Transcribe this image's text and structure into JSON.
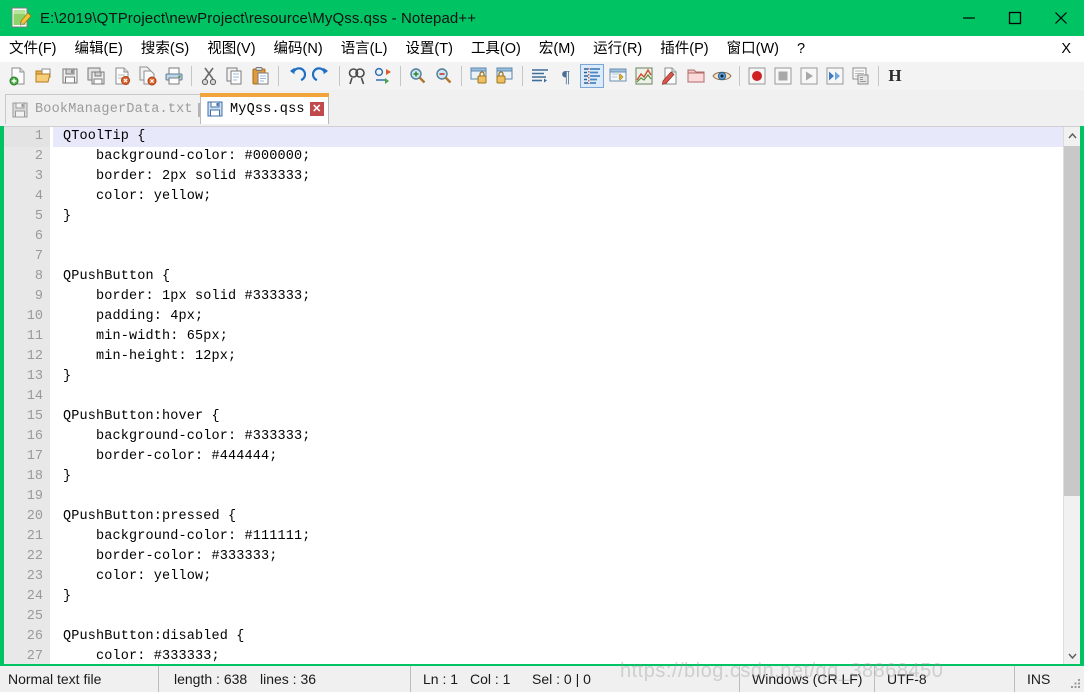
{
  "window": {
    "title": "E:\\2019\\QTProject\\newProject\\resource\\MyQss.qss - Notepad++",
    "icon": "notepad-document-icon",
    "titlebar_color": "#00c364",
    "controls": {
      "minimize": "minimize-icon",
      "maximize": "maximize-icon",
      "close": "close-icon"
    }
  },
  "menubar": {
    "items": [
      {
        "label": "文件(F)",
        "name": "menu-file"
      },
      {
        "label": "编辑(E)",
        "name": "menu-edit"
      },
      {
        "label": "搜索(S)",
        "name": "menu-search"
      },
      {
        "label": "视图(V)",
        "name": "menu-view"
      },
      {
        "label": "编码(N)",
        "name": "menu-encoding"
      },
      {
        "label": "语言(L)",
        "name": "menu-language"
      },
      {
        "label": "设置(T)",
        "name": "menu-settings"
      },
      {
        "label": "工具(O)",
        "name": "menu-tools"
      },
      {
        "label": "宏(M)",
        "name": "menu-macro"
      },
      {
        "label": "运行(R)",
        "name": "menu-run"
      },
      {
        "label": "插件(P)",
        "name": "menu-plugins"
      },
      {
        "label": "窗口(W)",
        "name": "menu-window"
      },
      {
        "label": "?",
        "name": "menu-help"
      }
    ],
    "close_doc_label": "X"
  },
  "toolbar": {
    "accent_active_bg": "#dcebfb",
    "buttons": [
      {
        "name": "new-file-icon"
      },
      {
        "name": "open-file-icon"
      },
      {
        "name": "save-icon"
      },
      {
        "name": "save-all-icon"
      },
      {
        "name": "close-file-icon"
      },
      {
        "name": "close-all-files-icon"
      },
      {
        "name": "print-icon"
      },
      {
        "name": "separator"
      },
      {
        "name": "cut-icon"
      },
      {
        "name": "copy-icon"
      },
      {
        "name": "paste-icon"
      },
      {
        "name": "separator"
      },
      {
        "name": "undo-icon"
      },
      {
        "name": "redo-icon"
      },
      {
        "name": "separator"
      },
      {
        "name": "find-icon"
      },
      {
        "name": "replace-icon"
      },
      {
        "name": "separator"
      },
      {
        "name": "zoom-in-icon"
      },
      {
        "name": "zoom-out-icon"
      },
      {
        "name": "separator"
      },
      {
        "name": "sync-vertical-scroll-icon"
      },
      {
        "name": "sync-horizontal-scroll-icon"
      },
      {
        "name": "separator"
      },
      {
        "name": "word-wrap-icon"
      },
      {
        "name": "show-all-characters-icon"
      },
      {
        "name": "indent-guide-icon",
        "active": true
      },
      {
        "name": "user-defined-language-icon"
      },
      {
        "name": "document-map-icon"
      },
      {
        "name": "function-list-icon"
      },
      {
        "name": "folder-as-workspace-icon"
      },
      {
        "name": "monitoring-icon"
      },
      {
        "name": "separator"
      },
      {
        "name": "record-macro-icon"
      },
      {
        "name": "stop-recording-icon"
      },
      {
        "name": "play-macro-icon"
      },
      {
        "name": "run-macro-multiple-icon"
      },
      {
        "name": "save-macro-icon"
      },
      {
        "name": "separator"
      }
    ],
    "hex_label": "H"
  },
  "tabs": [
    {
      "label": "BookManagerData.txt",
      "active": false,
      "icon": "floppy-disk-icon",
      "close": "✕"
    },
    {
      "label": "MyQss.qss",
      "active": true,
      "icon": "floppy-disk-icon",
      "close": "✕"
    }
  ],
  "editor": {
    "current_line": 1,
    "current_line_highlight": "#e8e8fb",
    "gutter_bg": "#e8e8e8",
    "lines": [
      {
        "n": "1",
        "text": "QToolTip {"
      },
      {
        "n": "2",
        "text": "    background-color: #000000;"
      },
      {
        "n": "3",
        "text": "    border: 2px solid #333333;"
      },
      {
        "n": "4",
        "text": "    color: yellow;"
      },
      {
        "n": "5",
        "text": "}"
      },
      {
        "n": "6",
        "text": ""
      },
      {
        "n": "7",
        "text": ""
      },
      {
        "n": "8",
        "text": "QPushButton {"
      },
      {
        "n": "9",
        "text": "    border: 1px solid #333333;"
      },
      {
        "n": "10",
        "text": "    padding: 4px;"
      },
      {
        "n": "11",
        "text": "    min-width: 65px;"
      },
      {
        "n": "12",
        "text": "    min-height: 12px;"
      },
      {
        "n": "13",
        "text": "}"
      },
      {
        "n": "14",
        "text": ""
      },
      {
        "n": "15",
        "text": "QPushButton:hover {"
      },
      {
        "n": "16",
        "text": "    background-color: #333333;"
      },
      {
        "n": "17",
        "text": "    border-color: #444444;"
      },
      {
        "n": "18",
        "text": "}"
      },
      {
        "n": "19",
        "text": ""
      },
      {
        "n": "20",
        "text": "QPushButton:pressed {"
      },
      {
        "n": "21",
        "text": "    background-color: #111111;"
      },
      {
        "n": "22",
        "text": "    border-color: #333333;"
      },
      {
        "n": "23",
        "text": "    color: yellow;"
      },
      {
        "n": "24",
        "text": "}"
      },
      {
        "n": "25",
        "text": ""
      },
      {
        "n": "26",
        "text": "QPushButton:disabled {"
      },
      {
        "n": "27",
        "text": "    color: #333333;"
      }
    ]
  },
  "statusbar": {
    "file_type": "Normal text file",
    "length": "length : 638",
    "lines": "lines : 36",
    "ln": "Ln : 1",
    "col": "Col : 1",
    "sel": "Sel : 0 | 0",
    "eol": "Windows (CR LF)",
    "encoding": "UTF-8",
    "mode": "INS"
  },
  "watermark": "https://blog.csdn.net/qq_38868450"
}
